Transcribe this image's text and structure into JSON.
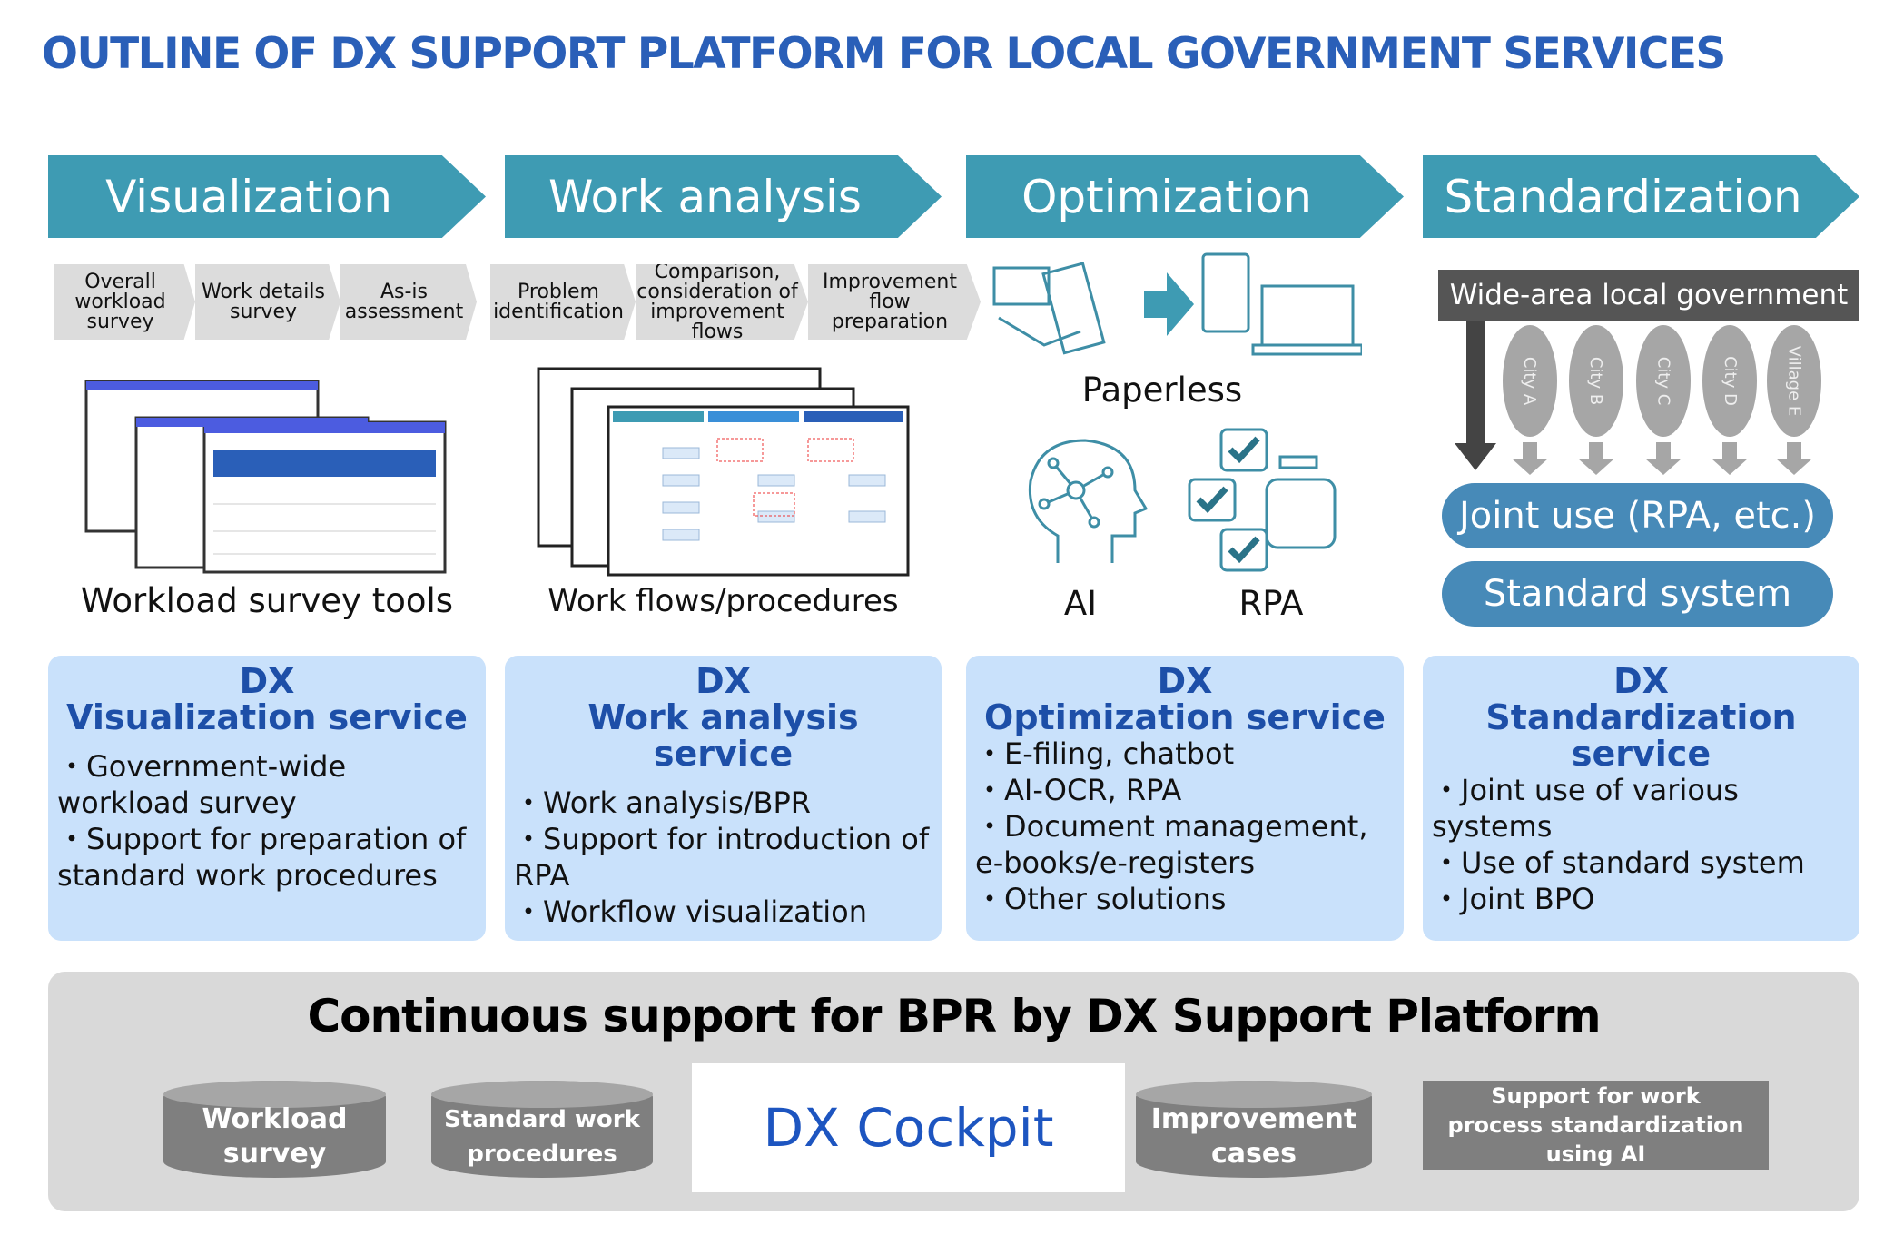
{
  "title": "OUTLINE OF DX SUPPORT PLATFORM FOR LOCAL GOVERNMENT SERVICES",
  "phases": [
    "Visualization",
    "Work analysis",
    "Optimization",
    "Standardization"
  ],
  "steps": [
    "Overall workload survey",
    "Work details survey",
    "As-is assessment",
    "Problem identification",
    "Comparison, consideration of improvement flows",
    "Improvement flow preparation"
  ],
  "images": {
    "workload": "Workload survey tools",
    "workflows": "Work flows/procedures",
    "paperless": "Paperless",
    "ai": "AI",
    "rpa": "RPA"
  },
  "standardization": {
    "wide_area": "Wide-area local government",
    "units": [
      "City A",
      "City B",
      "City C",
      "City D",
      "Village E"
    ],
    "joint_use": "Joint use (RPA, etc.)",
    "standard_system": "Standard system"
  },
  "services": [
    {
      "dx": "DX",
      "name": "Visualization service",
      "items": [
        "・Government-wide workload survey",
        "・Support for preparation of standard work procedures"
      ]
    },
    {
      "dx": "DX",
      "name": "Work analysis service",
      "items": [
        "・Work analysis/BPR",
        "・Support for introduction of RPA",
        "・Workflow visualization"
      ]
    },
    {
      "dx": "DX",
      "name": "Optimization service",
      "items": [
        "・E-filing, chatbot",
        "・AI-OCR, RPA",
        "・Document management, e-books/e-registers",
        "・Other solutions"
      ]
    },
    {
      "dx": "DX",
      "name": "Standardization service",
      "items": [
        "・Joint use of various systems",
        "・Use of standard system",
        "・Joint BPO"
      ]
    }
  ],
  "platform": {
    "title": "Continuous support for BPR by DX Support Platform",
    "workload": "Workload survey",
    "procedures": "Standard work procedures",
    "cockpit": "DX Cockpit",
    "cases": "Improvement cases",
    "ai_support": "Support for work process standardization using AI"
  },
  "colors": {
    "title": "#2a5fb8",
    "phase": "#3e9bb3",
    "service_bg": "#c9e1fb",
    "pill": "#478ab8",
    "db": "#7f7f7f"
  }
}
